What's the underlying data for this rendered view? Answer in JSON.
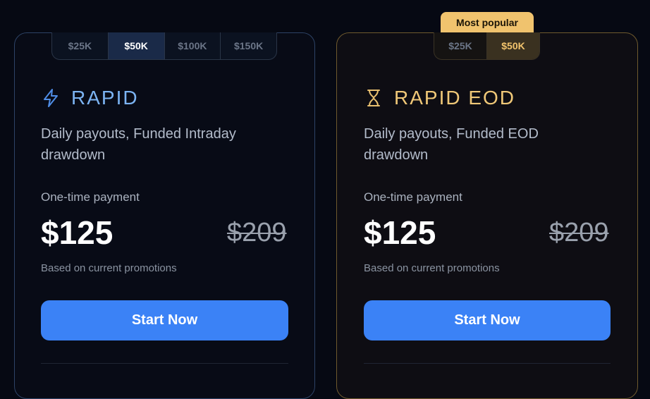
{
  "rapid": {
    "tabs": [
      {
        "label": "$25K",
        "active": false
      },
      {
        "label": "$50K",
        "active": true
      },
      {
        "label": "$100K",
        "active": false
      },
      {
        "label": "$150K",
        "active": false
      }
    ],
    "icon": "lightning-icon",
    "title": "RAPID",
    "description": "Daily payouts, Funded Intraday drawdown",
    "payment_label": "One-time payment",
    "price": "$125",
    "original_price": "$209",
    "promo_note": "Based on current promotions",
    "button_label": "Start Now",
    "accent_color": "#7cb4f3"
  },
  "rapid_eod": {
    "badge": "Most popular",
    "tabs": [
      {
        "label": "$25K",
        "active": false
      },
      {
        "label": "$50K",
        "active": true
      }
    ],
    "icon": "hourglass-icon",
    "title": "RAPID EOD",
    "description": "Daily payouts, Funded EOD drawdown",
    "payment_label": "One-time payment",
    "price": "$125",
    "original_price": "$209",
    "promo_note": "Based on current promotions",
    "button_label": "Start Now",
    "accent_color": "#f0c878"
  }
}
